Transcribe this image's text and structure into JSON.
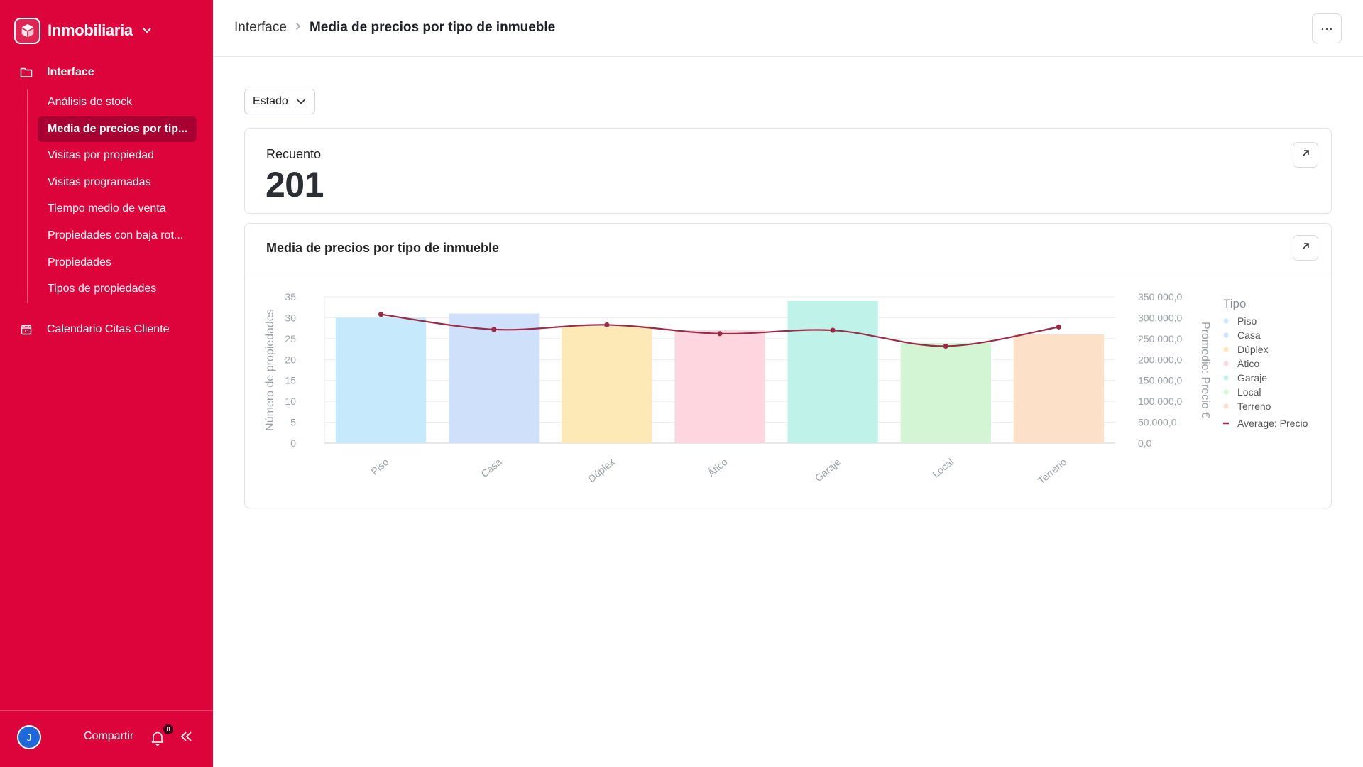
{
  "app": {
    "name": "Inmobiliaria"
  },
  "sidebar": {
    "section_label": "Interface",
    "items": [
      {
        "label": "Análisis de stock",
        "active": false
      },
      {
        "label": "Media de precios por tip...",
        "active": true
      },
      {
        "label": "Visitas por propiedad",
        "active": false
      },
      {
        "label": "Visitas programadas",
        "active": false
      },
      {
        "label": "Tiempo medio de venta",
        "active": false
      },
      {
        "label": "Propiedades con baja rot...",
        "active": false
      },
      {
        "label": "Propiedades",
        "active": false
      },
      {
        "label": "Tipos de propiedades",
        "active": false
      }
    ],
    "calendar_label": "Calendario Citas Cliente",
    "footer": {
      "avatar_initial": "J",
      "share_label": "Compartir",
      "notification_count": "8"
    },
    "accent_color": "#dc043b"
  },
  "breadcrumb": {
    "root": "Interface",
    "current": "Media de precios por tipo de inmueble"
  },
  "toolbar": {
    "more_label": "···"
  },
  "filter": {
    "label": "Estado"
  },
  "kpi": {
    "label": "Recuento",
    "value": "201"
  },
  "chart_card": {
    "title": "Media de precios por tipo de inmueble"
  },
  "chart_data": {
    "type": "bar",
    "categories": [
      "Piso",
      "Casa",
      "Dúplex",
      "Ático",
      "Garaje",
      "Local",
      "Terreno"
    ],
    "series": [
      {
        "name": "Tipo",
        "kind": "bar",
        "axis": "left",
        "values": [
          30,
          31,
          28,
          27,
          34,
          24,
          26
        ]
      },
      {
        "name": "Average: Precio",
        "kind": "line",
        "axis": "right",
        "values": [
          308000,
          272000,
          283000,
          262000,
          270000,
          232000,
          278000
        ]
      }
    ],
    "bar_colors": [
      "#c6eafb",
      "#cfe0fb",
      "#fde9b6",
      "#fdd6e0",
      "#bff3ea",
      "#d3f5d3",
      "#fde0c8"
    ],
    "line_color": "#9b2c48",
    "ylabel": "Número de propiedades",
    "ylabel_right": "Promedio: Precio €",
    "ylim": [
      0,
      35
    ],
    "yticks": [
      "0",
      "5",
      "10",
      "15",
      "20",
      "25",
      "30",
      "35"
    ],
    "ylim_right": [
      0,
      350000
    ],
    "yticks_right": [
      "0,0",
      "50.000,0",
      "100.000,0",
      "150.000,0",
      "200.000,0",
      "250.000,0",
      "300.000,0",
      "350.000,0"
    ],
    "legend_title": "Tipo",
    "legend": [
      "Piso",
      "Casa",
      "Dúplex",
      "Ático",
      "Garaje",
      "Local",
      "Terreno",
      "Average: Precio"
    ],
    "legend_position": "right",
    "grid": true
  }
}
